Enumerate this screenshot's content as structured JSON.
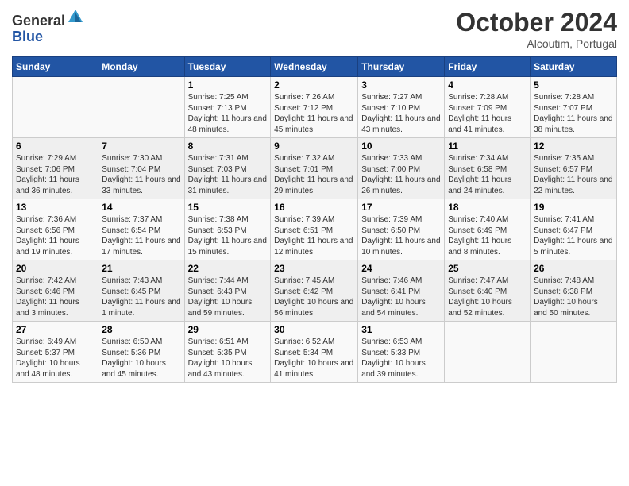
{
  "header": {
    "logo_general": "General",
    "logo_blue": "Blue",
    "month_title": "October 2024",
    "location": "Alcoutim, Portugal"
  },
  "days_of_week": [
    "Sunday",
    "Monday",
    "Tuesday",
    "Wednesday",
    "Thursday",
    "Friday",
    "Saturday"
  ],
  "weeks": [
    [
      {
        "day": "",
        "info": ""
      },
      {
        "day": "",
        "info": ""
      },
      {
        "day": "1",
        "info": "Sunrise: 7:25 AM\nSunset: 7:13 PM\nDaylight: 11 hours and 48 minutes."
      },
      {
        "day": "2",
        "info": "Sunrise: 7:26 AM\nSunset: 7:12 PM\nDaylight: 11 hours and 45 minutes."
      },
      {
        "day": "3",
        "info": "Sunrise: 7:27 AM\nSunset: 7:10 PM\nDaylight: 11 hours and 43 minutes."
      },
      {
        "day": "4",
        "info": "Sunrise: 7:28 AM\nSunset: 7:09 PM\nDaylight: 11 hours and 41 minutes."
      },
      {
        "day": "5",
        "info": "Sunrise: 7:28 AM\nSunset: 7:07 PM\nDaylight: 11 hours and 38 minutes."
      }
    ],
    [
      {
        "day": "6",
        "info": "Sunrise: 7:29 AM\nSunset: 7:06 PM\nDaylight: 11 hours and 36 minutes."
      },
      {
        "day": "7",
        "info": "Sunrise: 7:30 AM\nSunset: 7:04 PM\nDaylight: 11 hours and 33 minutes."
      },
      {
        "day": "8",
        "info": "Sunrise: 7:31 AM\nSunset: 7:03 PM\nDaylight: 11 hours and 31 minutes."
      },
      {
        "day": "9",
        "info": "Sunrise: 7:32 AM\nSunset: 7:01 PM\nDaylight: 11 hours and 29 minutes."
      },
      {
        "day": "10",
        "info": "Sunrise: 7:33 AM\nSunset: 7:00 PM\nDaylight: 11 hours and 26 minutes."
      },
      {
        "day": "11",
        "info": "Sunrise: 7:34 AM\nSunset: 6:58 PM\nDaylight: 11 hours and 24 minutes."
      },
      {
        "day": "12",
        "info": "Sunrise: 7:35 AM\nSunset: 6:57 PM\nDaylight: 11 hours and 22 minutes."
      }
    ],
    [
      {
        "day": "13",
        "info": "Sunrise: 7:36 AM\nSunset: 6:56 PM\nDaylight: 11 hours and 19 minutes."
      },
      {
        "day": "14",
        "info": "Sunrise: 7:37 AM\nSunset: 6:54 PM\nDaylight: 11 hours and 17 minutes."
      },
      {
        "day": "15",
        "info": "Sunrise: 7:38 AM\nSunset: 6:53 PM\nDaylight: 11 hours and 15 minutes."
      },
      {
        "day": "16",
        "info": "Sunrise: 7:39 AM\nSunset: 6:51 PM\nDaylight: 11 hours and 12 minutes."
      },
      {
        "day": "17",
        "info": "Sunrise: 7:39 AM\nSunset: 6:50 PM\nDaylight: 11 hours and 10 minutes."
      },
      {
        "day": "18",
        "info": "Sunrise: 7:40 AM\nSunset: 6:49 PM\nDaylight: 11 hours and 8 minutes."
      },
      {
        "day": "19",
        "info": "Sunrise: 7:41 AM\nSunset: 6:47 PM\nDaylight: 11 hours and 5 minutes."
      }
    ],
    [
      {
        "day": "20",
        "info": "Sunrise: 7:42 AM\nSunset: 6:46 PM\nDaylight: 11 hours and 3 minutes."
      },
      {
        "day": "21",
        "info": "Sunrise: 7:43 AM\nSunset: 6:45 PM\nDaylight: 11 hours and 1 minute."
      },
      {
        "day": "22",
        "info": "Sunrise: 7:44 AM\nSunset: 6:43 PM\nDaylight: 10 hours and 59 minutes."
      },
      {
        "day": "23",
        "info": "Sunrise: 7:45 AM\nSunset: 6:42 PM\nDaylight: 10 hours and 56 minutes."
      },
      {
        "day": "24",
        "info": "Sunrise: 7:46 AM\nSunset: 6:41 PM\nDaylight: 10 hours and 54 minutes."
      },
      {
        "day": "25",
        "info": "Sunrise: 7:47 AM\nSunset: 6:40 PM\nDaylight: 10 hours and 52 minutes."
      },
      {
        "day": "26",
        "info": "Sunrise: 7:48 AM\nSunset: 6:38 PM\nDaylight: 10 hours and 50 minutes."
      }
    ],
    [
      {
        "day": "27",
        "info": "Sunrise: 6:49 AM\nSunset: 5:37 PM\nDaylight: 10 hours and 48 minutes."
      },
      {
        "day": "28",
        "info": "Sunrise: 6:50 AM\nSunset: 5:36 PM\nDaylight: 10 hours and 45 minutes."
      },
      {
        "day": "29",
        "info": "Sunrise: 6:51 AM\nSunset: 5:35 PM\nDaylight: 10 hours and 43 minutes."
      },
      {
        "day": "30",
        "info": "Sunrise: 6:52 AM\nSunset: 5:34 PM\nDaylight: 10 hours and 41 minutes."
      },
      {
        "day": "31",
        "info": "Sunrise: 6:53 AM\nSunset: 5:33 PM\nDaylight: 10 hours and 39 minutes."
      },
      {
        "day": "",
        "info": ""
      },
      {
        "day": "",
        "info": ""
      }
    ]
  ]
}
